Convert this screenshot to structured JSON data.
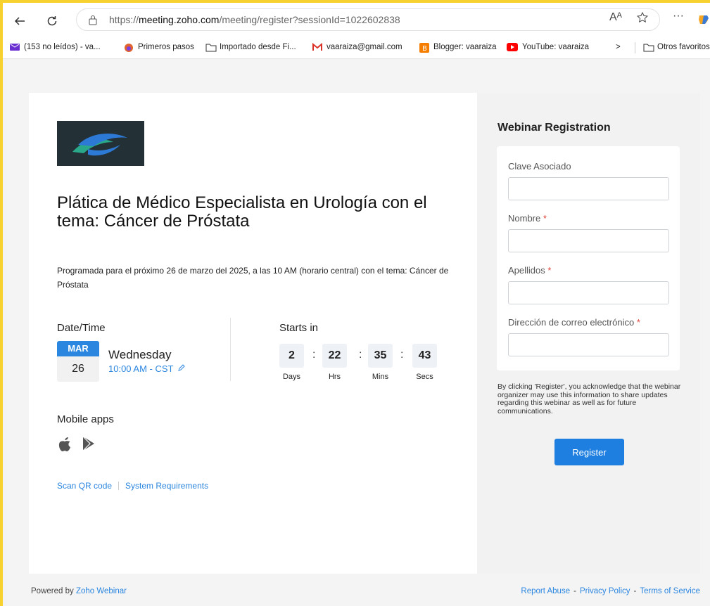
{
  "browser": {
    "url_prefix": "https://",
    "url_domain": "meeting.zoho.com",
    "url_path": "/meeting/register?sessionId=1022602838",
    "read_aloud_icon": "Aᴬ",
    "more_label": "···"
  },
  "bookmarks": [
    {
      "label": "(153 no leídos) - va...",
      "icon": "mail-icon",
      "color": "#6a2fd1"
    },
    {
      "label": "Primeros pasos",
      "icon": "firefox-icon",
      "color": "#e0622e"
    },
    {
      "label": "Importado desde Fi...",
      "icon": "folder-icon",
      "color": "#333333"
    },
    {
      "label": "vaaraiza@gmail.com",
      "icon": "gmail-icon",
      "color": "#d93025"
    },
    {
      "label": "Blogger: vaaraiza",
      "icon": "blogger-icon",
      "color": "#f57d00"
    },
    {
      "label": "YouTube: vaaraiza",
      "icon": "youtube-icon",
      "color": "#ff0000"
    },
    {
      "label": ">",
      "icon": "chevron-right-icon",
      "color": "#333333"
    },
    {
      "label": "Otros favoritos",
      "icon": "folder-icon",
      "color": "#333333"
    }
  ],
  "event": {
    "title": "Plática de Médico Especialista en Urología con el tema: Cáncer de Próstata",
    "description": "Programada para el próximo 26 de marzo del 2025, a las 10 AM (horario central) con el tema: Cáncer de Próstata",
    "date_time_label": "Date/Time",
    "month": "MAR",
    "day": "26",
    "weekday": "Wednesday",
    "time": "10:00 AM - CST",
    "starts_in_label": "Starts in",
    "countdown": [
      {
        "value": "2",
        "unit": "Days"
      },
      {
        "value": "22",
        "unit": "Hrs"
      },
      {
        "value": "35",
        "unit": "Mins"
      },
      {
        "value": "43",
        "unit": "Secs"
      }
    ],
    "mobile_apps_label": "Mobile apps",
    "scan_qr": "Scan QR code",
    "system_requirements": "System Requirements"
  },
  "registration": {
    "title": "Webinar Registration",
    "fields": [
      {
        "label": "Clave Asociado",
        "required": false,
        "value": ""
      },
      {
        "label": "Nombre",
        "required": true,
        "value": ""
      },
      {
        "label": "Apellidos",
        "required": true,
        "value": ""
      },
      {
        "label": "Dirección de correo electrónico",
        "required": true,
        "value": ""
      }
    ],
    "required_mark": "*",
    "consent": "By clicking 'Register', you acknowledge that the webinar organizer may use this information to share updates regarding this webinar as well as for future communications.",
    "register_button": "Register"
  },
  "footer": {
    "powered_by": "Powered by",
    "powered_brand": "Zoho Webinar",
    "report_abuse": "Report Abuse",
    "privacy_policy": "Privacy Policy",
    "terms": "Terms of Service",
    "separator": "-"
  },
  "colors": {
    "accent": "#1e7fe0",
    "required": "#e0463b",
    "frame": "#f7d12e"
  }
}
